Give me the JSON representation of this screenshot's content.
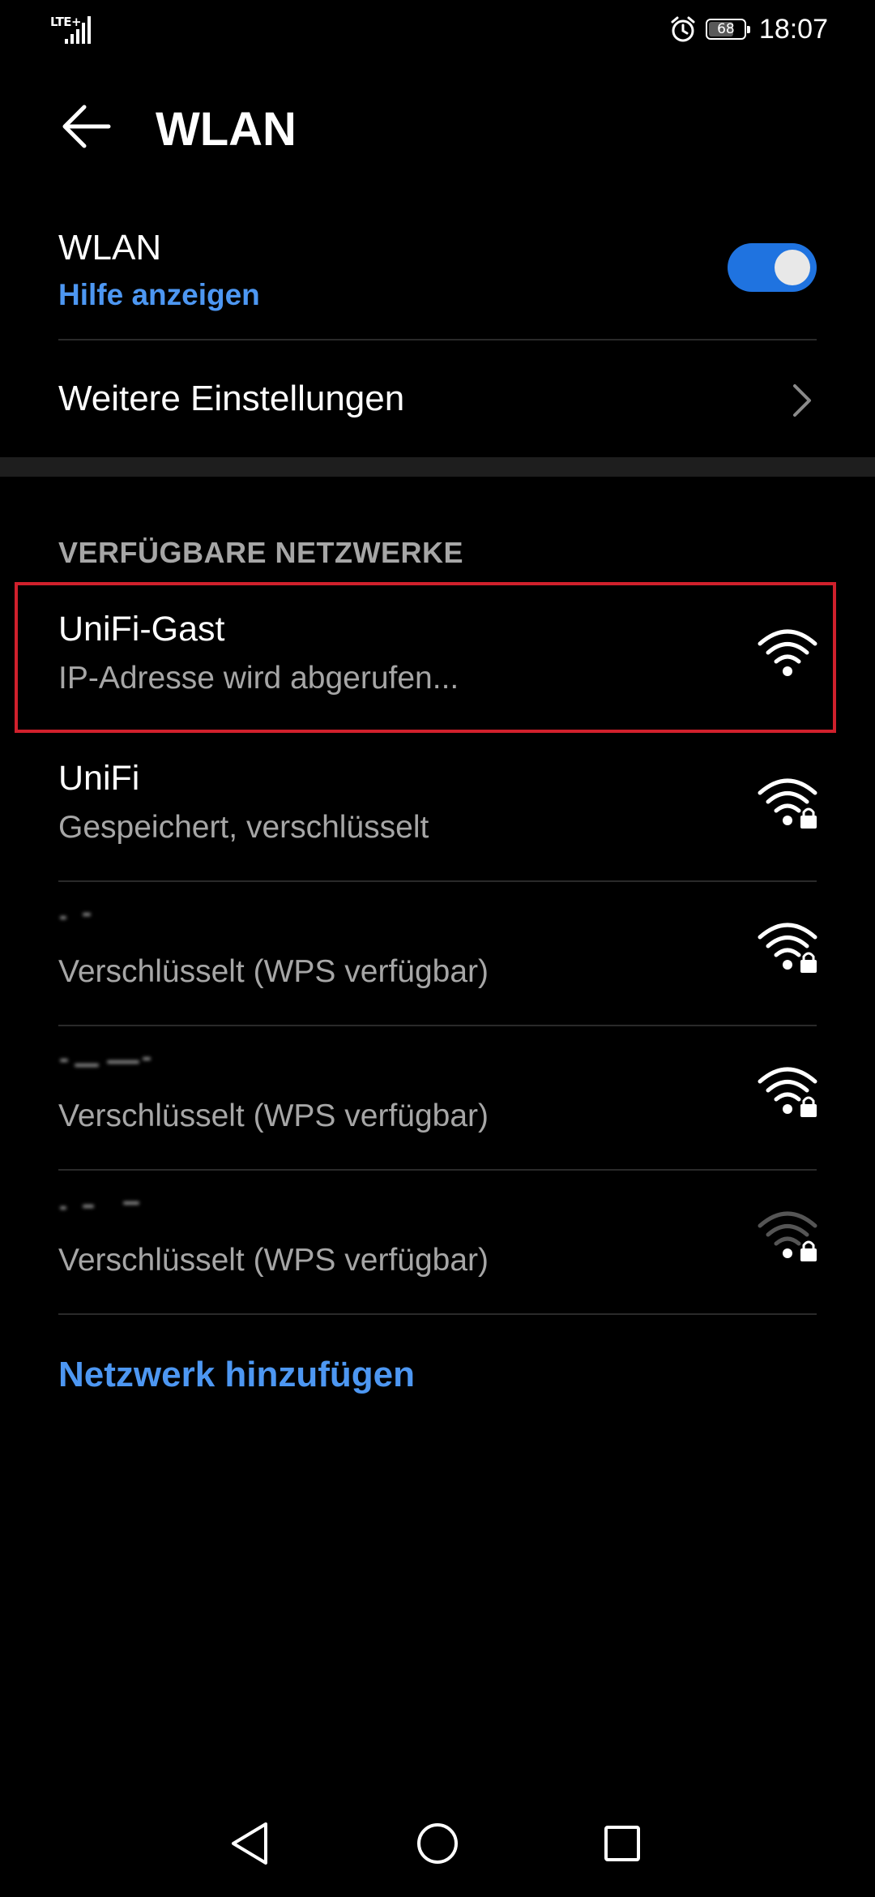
{
  "status_bar": {
    "network_type": "LTE+",
    "battery": "68",
    "time": "18:07",
    "icons": [
      "signal-icon",
      "alarm-icon",
      "battery-icon"
    ]
  },
  "header": {
    "title": "WLAN",
    "back_icon": "arrow-left-icon"
  },
  "wlan": {
    "label": "WLAN",
    "help_link": "Hilfe anzeigen",
    "enabled": true
  },
  "more_settings": {
    "label": "Weitere Einstellungen",
    "icon": "chevron-right-icon"
  },
  "available_networks": {
    "header": "VERFÜGBARE NETZWERKE",
    "items": [
      {
        "name": "UniFi-Gast",
        "status": "IP-Adresse wird abgerufen...",
        "secured": false,
        "signal": "strong"
      },
      {
        "name": "UniFi",
        "status": "Gespeichert, verschlüsselt",
        "secured": true,
        "signal": "strong"
      },
      {
        "name": "",
        "status": "Verschlüsselt (WPS verfügbar)",
        "secured": true,
        "signal": "strong"
      },
      {
        "name": "",
        "status": "Verschlüsselt (WPS verfügbar)",
        "secured": true,
        "signal": "strong"
      },
      {
        "name": "",
        "status": "Verschlüsselt (WPS verfügbar)",
        "secured": true,
        "signal": "weak"
      }
    ]
  },
  "add_network": "Netzwerk hinzufügen",
  "colors": {
    "background": "#000000",
    "accent": "#4d97f2",
    "toggle_on": "#1f73e0",
    "highlight": "#d0202c",
    "secondary_text": "#a6a6a6"
  },
  "nav_bar": {
    "icons": [
      "back-triangle-icon",
      "home-circle-icon",
      "recents-square-icon"
    ]
  }
}
